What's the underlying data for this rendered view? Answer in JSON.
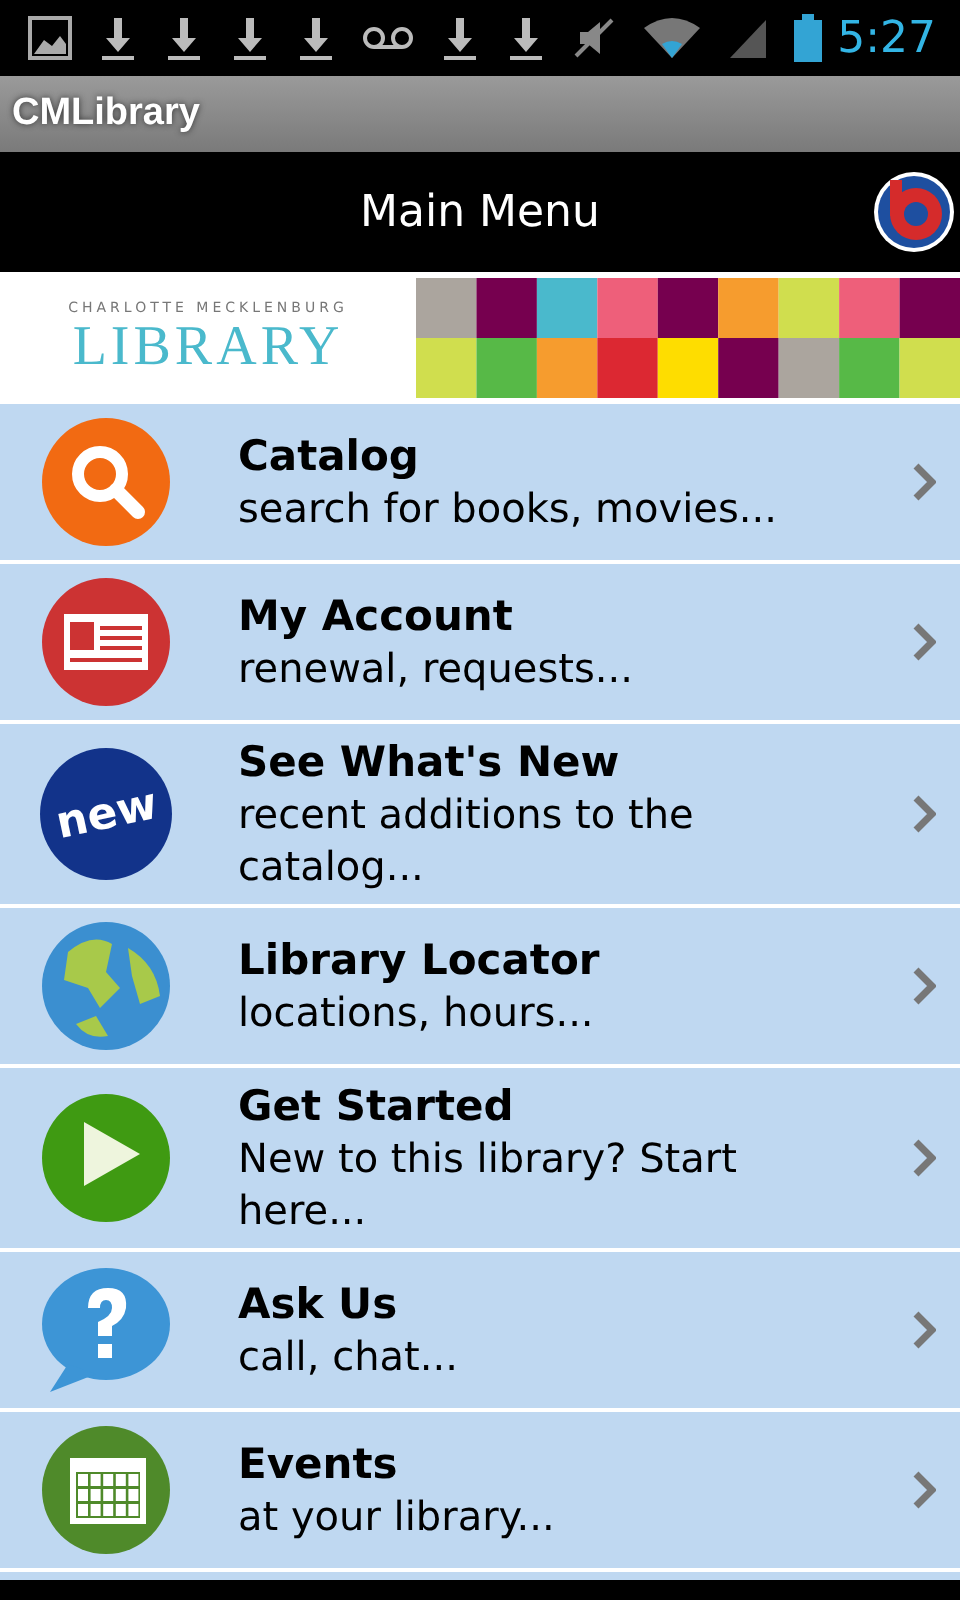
{
  "status_bar": {
    "time": "5:27"
  },
  "app_bar": {
    "title": "CMLibrary"
  },
  "header": {
    "title": "Main Menu"
  },
  "banner": {
    "subtitle": "CHARLOTTE MECKLENBURG",
    "name": "LIBRARY"
  },
  "menu": [
    {
      "kind": "search",
      "title": "Catalog",
      "subtitle": "search for books, movies..."
    },
    {
      "kind": "account",
      "title": "My Account",
      "subtitle": "renewal, requests..."
    },
    {
      "kind": "new",
      "icon_text": "new",
      "title": "See What's New",
      "subtitle": "recent additions to the catalog..."
    },
    {
      "kind": "globe",
      "title": "Library Locator",
      "subtitle": "locations, hours..."
    },
    {
      "kind": "play",
      "title": "Get Started",
      "subtitle": "New to this library? Start here..."
    },
    {
      "kind": "help",
      "title": "Ask Us",
      "subtitle": "call, chat..."
    },
    {
      "kind": "calendar",
      "title": "Events",
      "subtitle": "at your library..."
    }
  ]
}
